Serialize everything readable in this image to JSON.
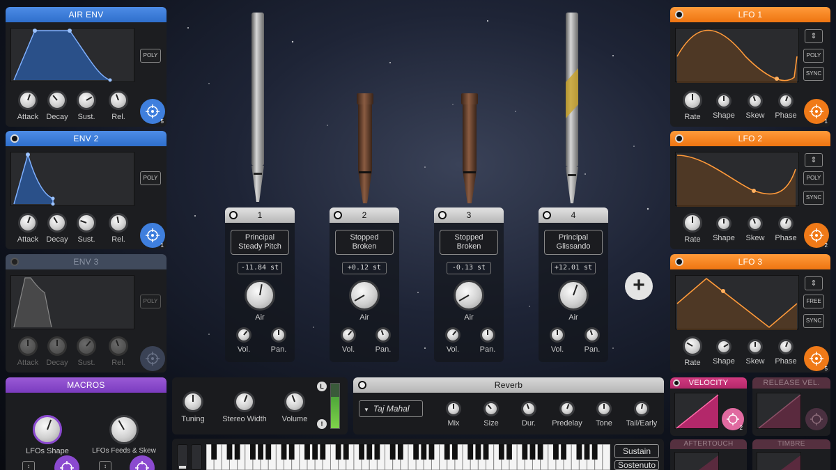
{
  "air_env": {
    "title": "AIR ENV",
    "mode": "POLY",
    "knobs": [
      "Attack",
      "Decay",
      "Sust.",
      "Rel."
    ],
    "target_num": "5"
  },
  "env2": {
    "title": "ENV 2",
    "mode": "POLY",
    "knobs": [
      "Attack",
      "Decay",
      "Sust.",
      "Rel."
    ],
    "target_num": "1"
  },
  "env3": {
    "title": "ENV 3",
    "mode": "POLY",
    "knobs": [
      "Attack",
      "Decay",
      "Sust.",
      "Rel."
    ]
  },
  "macros": {
    "title": "MACROS",
    "knobs": [
      "LFOs Shape",
      "LFOs Feeds & Skew"
    ]
  },
  "lfo1": {
    "title": "LFO 1",
    "mode": "POLY",
    "sync": "SYNC",
    "knobs": [
      "Rate",
      "Shape",
      "Skew",
      "Phase"
    ],
    "target_num": "1"
  },
  "lfo2": {
    "title": "LFO 2",
    "mode": "POLY",
    "sync": "SYNC",
    "knobs": [
      "Rate",
      "Shape",
      "Skew",
      "Phase"
    ],
    "target_num": "2"
  },
  "lfo3": {
    "title": "LFO 3",
    "mode": "FREE",
    "sync": "SYNC",
    "knobs": [
      "Rate",
      "Shape",
      "Skew",
      "Phase"
    ],
    "target_num": "5"
  },
  "pipes": [
    {
      "num": "1",
      "preset_line1": "Principal",
      "preset_line2": "Steady Pitch",
      "tune": "-11.84 st",
      "air": "Air",
      "vol": "Vol.",
      "pan": "Pan."
    },
    {
      "num": "2",
      "preset_line1": "Stopped",
      "preset_line2": "Broken",
      "tune": "+0.12 st",
      "air": "Air",
      "vol": "Vol.",
      "pan": "Pan."
    },
    {
      "num": "3",
      "preset_line1": "Stopped",
      "preset_line2": "Broken",
      "tune": "-0.13 st",
      "air": "Air",
      "vol": "Vol.",
      "pan": "Pan."
    },
    {
      "num": "4",
      "preset_line1": "Principal",
      "preset_line2": "Glissando",
      "tune": "+12.01 st",
      "air": "Air",
      "vol": "Vol.",
      "pan": "Pan."
    }
  ],
  "master": {
    "knobs": [
      "Tuning",
      "Stereo Width",
      "Volume"
    ],
    "meter_top": "L",
    "meter_bottom": "!"
  },
  "reverb": {
    "title": "Reverb",
    "preset": "Taj Mahal",
    "knobs": [
      "Mix",
      "Size",
      "Dur.",
      "Predelay",
      "Tone",
      "Tail/Early"
    ]
  },
  "velocity": {
    "title": "VELOCITY",
    "target_num": "2"
  },
  "release_vel": {
    "title": "RELEASE VEL."
  },
  "aftertouch": {
    "title": "AFTERTOUCH"
  },
  "timbre": {
    "title": "TIMBRE"
  },
  "keyboard": {
    "sustain": "Sustain",
    "sostenuto": "Sostenuto"
  },
  "colors": {
    "env_blue": "#3f7fdd",
    "lfo_orange": "#f07a18",
    "macro_purple": "#8b4ad0",
    "velocity_pink": "#b3286a"
  }
}
